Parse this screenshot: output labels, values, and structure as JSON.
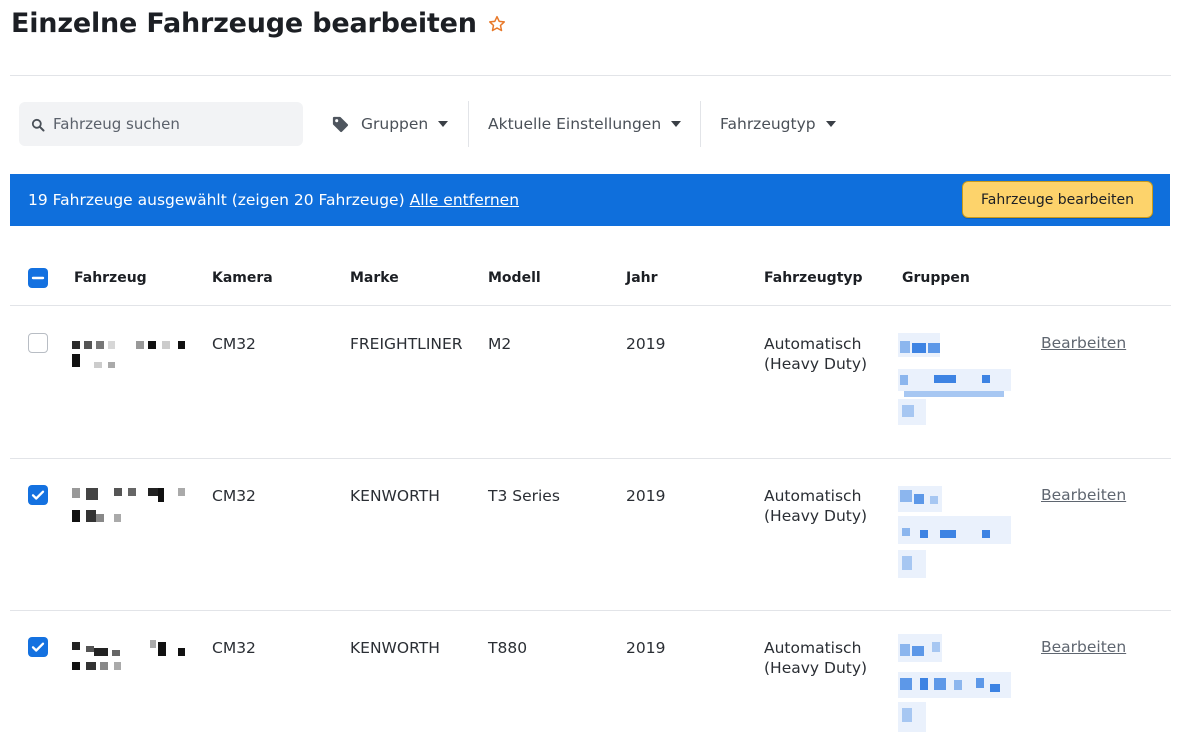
{
  "header": {
    "title": "Einzelne Fahrzeuge bearbeiten",
    "favorite_icon": "star-outline-icon",
    "accent_color": "#e8792a"
  },
  "toolbar": {
    "search_placeholder": "Fahrzeug suchen",
    "filters": {
      "groups": "Gruppen",
      "current_settings": "Aktuelle Einstellungen",
      "vehicle_type": "Fahrzeugtyp"
    }
  },
  "selection_banner": {
    "text": "19 Fahrzeuge ausgewählt (zeigen 20 Fahrzeuge)",
    "remove_all": "Alle entfernen",
    "edit_button": "Fahrzeuge bearbeiten",
    "background_color": "#0f6fdc",
    "button_color": "#fdd36b"
  },
  "table": {
    "header_checkbox_state": "indeterminate",
    "columns": {
      "vehicle": "Fahrzeug",
      "camera": "Kamera",
      "brand": "Marke",
      "model": "Modell",
      "year": "Jahr",
      "vehicle_type": "Fahrzeugtyp",
      "groups": "Gruppen"
    },
    "rows": [
      {
        "checked": false,
        "camera": "CM32",
        "brand": "FREIGHTLINER",
        "model": "M2",
        "year": "2019",
        "type_line1": "Automatisch",
        "type_line2": "(Heavy Duty)",
        "action": "Bearbeiten"
      },
      {
        "checked": true,
        "camera": "CM32",
        "brand": "KENWORTH",
        "model": "T3 Series",
        "year": "2019",
        "type_line1": "Automatisch",
        "type_line2": "(Heavy Duty)",
        "action": "Bearbeiten"
      },
      {
        "checked": true,
        "camera": "CM32",
        "brand": "KENWORTH",
        "model": "T880",
        "year": "2019",
        "type_line1": "Automatisch",
        "type_line2": "(Heavy Duty)",
        "action": "Bearbeiten"
      }
    ]
  }
}
